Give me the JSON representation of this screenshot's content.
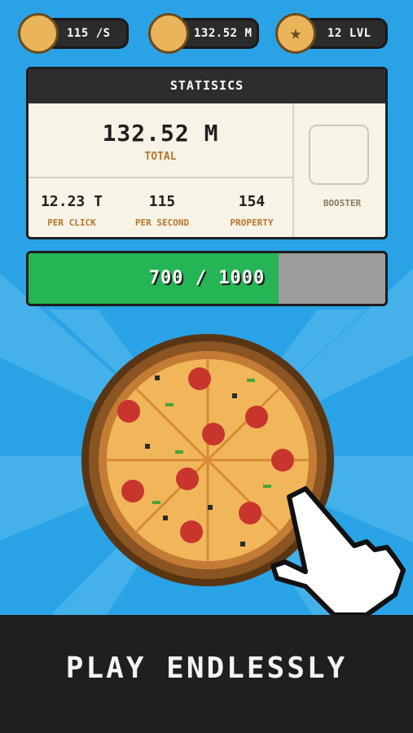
{
  "topbar": {
    "rate": "115 /S",
    "total": "132.52 M",
    "level": "12 LVL"
  },
  "stats_panel": {
    "title": "STATISICS",
    "total_value": "132.52 M",
    "total_label": "TOTAL",
    "per_click_value": "12.23 T",
    "per_click_label": "PER CLICK",
    "per_second_value": "115",
    "per_second_label": "PER SECOND",
    "property_value": "154",
    "property_label": "PROPERTY",
    "booster_label": "BOOSTER"
  },
  "progress": {
    "text": "700 / 1000",
    "current": 700,
    "max": 1000
  },
  "banner": {
    "text": "PLAY ENDLESSLY"
  },
  "colors": {
    "sky": "#2fa6e8",
    "panel": "#f7f3e6",
    "progress_fill": "#25b554",
    "accent_label": "#b7762e"
  }
}
